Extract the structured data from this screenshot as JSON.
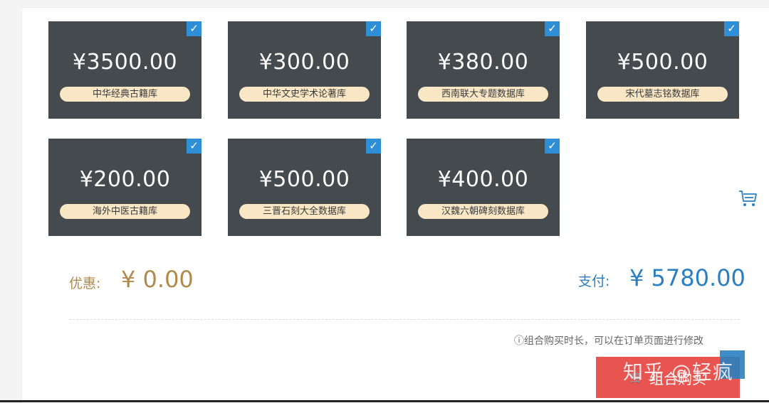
{
  "products": [
    {
      "price": "¥3500.00",
      "name": "中华经典古籍库",
      "selected": true
    },
    {
      "price": "¥300.00",
      "name": "中华文史学术论著库",
      "selected": true
    },
    {
      "price": "¥380.00",
      "name": "西南联大专题数据库",
      "selected": true
    },
    {
      "price": "¥500.00",
      "name": "宋代墓志铭数据库",
      "selected": true
    },
    {
      "price": "¥200.00",
      "name": "海外中医古籍库",
      "selected": true
    },
    {
      "price": "¥500.00",
      "name": "三晋石刻大全数据库",
      "selected": true
    },
    {
      "price": "¥400.00",
      "name": "汉魏六朝碑刻数据库",
      "selected": true
    }
  ],
  "summary": {
    "discount_label": "优惠:",
    "discount_value": "¥ 0.00",
    "pay_label": "支付:",
    "pay_value": "¥ 5780.00"
  },
  "note": "ⓘ组合购买时长，可以在订单页面进行修改",
  "buy_button": {
    "label": "组合购买"
  },
  "watermark": "知乎 @轻疯",
  "icons": {
    "check": "checkmark-icon",
    "side": "cart-icon"
  },
  "colors": {
    "card_bg": "#454a4f",
    "tag_bg": "#f8e6c5",
    "check_bg": "#2e8fd6",
    "discount": "#b08a4a",
    "pay": "#2a7fc0",
    "button": "#e85450"
  }
}
